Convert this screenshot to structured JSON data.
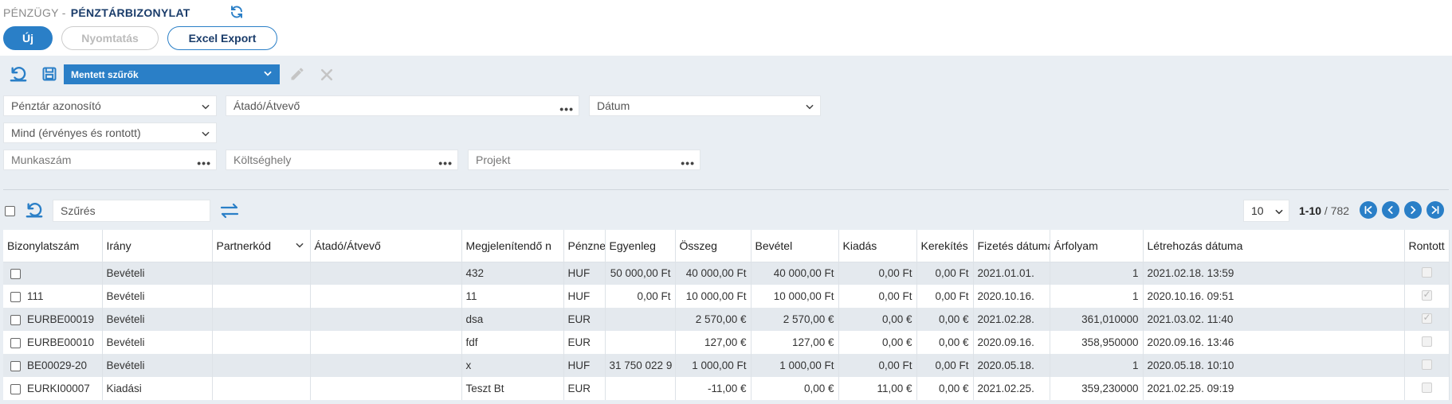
{
  "header": {
    "module": "PÉNZÜGY -",
    "page": "PÉNZTÁRBIZONYLAT"
  },
  "actions": {
    "new": "Új",
    "print": "Nyomtatás",
    "excel": "Excel Export"
  },
  "filters": {
    "saved_filters": "Mentett szűrők",
    "cash_register": "Pénztár azonosító",
    "handover": "Átadó/Átvevő",
    "date": "Dátum",
    "status": "Mind (érvényes és rontott)",
    "work_number": "Munkaszám",
    "cost_center": "Költséghely",
    "project": "Projekt"
  },
  "toolbar": {
    "search_placeholder": "Szűrés",
    "page_size": "10",
    "range": "1-10",
    "total": "/ 782"
  },
  "table": {
    "columns": [
      "Bizonylatszám",
      "Irány",
      "Partnerkód",
      "Átadó/Átvevő",
      "Megjelenítendő n",
      "Pénznem",
      "Egyenleg",
      "Összeg",
      "Bevétel",
      "Kiadás",
      "Kerekítés",
      "Fizetés dátuma",
      "Árfolyam",
      "Létrehozás dátuma",
      "Rontott"
    ],
    "rows": [
      {
        "id": "",
        "dir": "Bevételi",
        "partner": "",
        "handover": "",
        "display": "432",
        "cur": "HUF",
        "balance": "50 000,00 Ft",
        "amount": "40 000,00 Ft",
        "income": "40 000,00 Ft",
        "expense": "0,00 Ft",
        "rounding": "0,00 Ft",
        "paydate": "2021.01.01.",
        "rate": "1",
        "created": "2021.02.18. 13:59"
      },
      {
        "id": "111",
        "dir": "Bevételi",
        "partner": "",
        "handover": "",
        "display": "11",
        "cur": "HUF",
        "balance": "0,00 Ft",
        "amount": "10 000,00 Ft",
        "income": "10 000,00 Ft",
        "expense": "0,00 Ft",
        "rounding": "0,00 Ft",
        "paydate": "2020.10.16.",
        "rate": "1",
        "created": "2020.10.16. 09:51"
      },
      {
        "id": "EURBE00019",
        "dir": "Bevételi",
        "partner": "",
        "handover": "",
        "display": "dsa",
        "cur": "EUR",
        "balance": "",
        "amount": "2 570,00 €",
        "income": "2 570,00 €",
        "expense": "0,00 €",
        "rounding": "0,00 €",
        "paydate": "2021.02.28.",
        "rate": "361,010000",
        "created": "2021.03.02. 11:40"
      },
      {
        "id": "EURBE00010",
        "dir": "Bevételi",
        "partner": "",
        "handover": "",
        "display": "fdf",
        "cur": "EUR",
        "balance": "",
        "amount": "127,00 €",
        "income": "127,00 €",
        "expense": "0,00 €",
        "rounding": "0,00 €",
        "paydate": "2020.09.16.",
        "rate": "358,950000",
        "created": "2020.09.16. 13:46"
      },
      {
        "id": "BE00029-20",
        "dir": "Bevételi",
        "partner": "",
        "handover": "",
        "display": "x",
        "cur": "HUF",
        "balance": "31 750 022 9",
        "amount": "1 000,00 Ft",
        "income": "1 000,00 Ft",
        "expense": "0,00 Ft",
        "rounding": "0,00 Ft",
        "paydate": "2020.05.18.",
        "rate": "1",
        "created": "2020.05.18. 10:10"
      },
      {
        "id": "EURKI00007",
        "dir": "Kiadási",
        "partner": "",
        "handover": "",
        "display": "Teszt Bt",
        "cur": "EUR",
        "balance": "",
        "amount": "-11,00 €",
        "income": "0,00 €",
        "expense": "11,00 €",
        "rounding": "0,00 €",
        "paydate": "2021.02.25.",
        "rate": "359,230000",
        "created": "2021.02.25. 09:19"
      }
    ]
  }
}
